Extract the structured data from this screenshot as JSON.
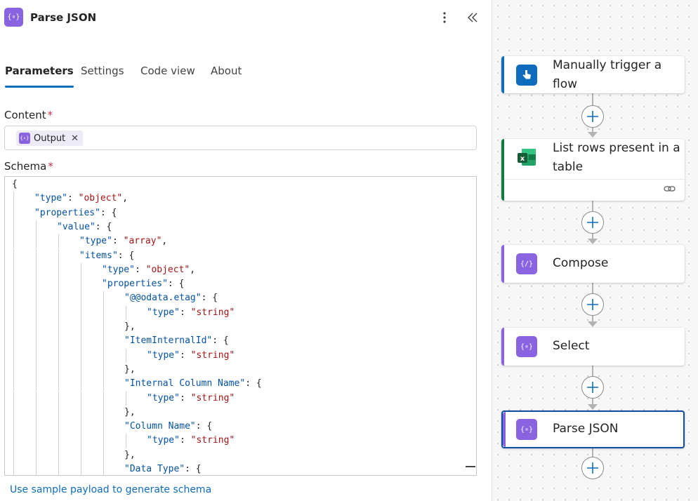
{
  "panel": {
    "title": "Parse JSON",
    "icon": "curly-braces-icon",
    "accent_color": "#8a63e0",
    "tabs": [
      {
        "label": "Parameters",
        "active": true
      },
      {
        "label": "Settings",
        "active": false
      },
      {
        "label": "Code view",
        "active": false
      },
      {
        "label": "About",
        "active": false
      }
    ]
  },
  "content_field": {
    "label": "Content",
    "required_mark": "*",
    "token_label": "Output"
  },
  "schema_field": {
    "label": "Schema",
    "required_mark": "*",
    "lines": [
      {
        "indent": 0,
        "parts": [
          [
            "p",
            "{"
          ]
        ]
      },
      {
        "indent": 1,
        "parts": [
          [
            "k",
            "\"type\""
          ],
          [
            "p",
            ": "
          ],
          [
            "s",
            "\"object\""
          ],
          [
            "p",
            ","
          ]
        ]
      },
      {
        "indent": 1,
        "parts": [
          [
            "k",
            "\"properties\""
          ],
          [
            "p",
            ": {"
          ]
        ]
      },
      {
        "indent": 2,
        "parts": [
          [
            "k",
            "\"value\""
          ],
          [
            "p",
            ": {"
          ]
        ]
      },
      {
        "indent": 3,
        "parts": [
          [
            "k",
            "\"type\""
          ],
          [
            "p",
            ": "
          ],
          [
            "s",
            "\"array\""
          ],
          [
            "p",
            ","
          ]
        ]
      },
      {
        "indent": 3,
        "parts": [
          [
            "k",
            "\"items\""
          ],
          [
            "p",
            ": {"
          ]
        ]
      },
      {
        "indent": 4,
        "parts": [
          [
            "k",
            "\"type\""
          ],
          [
            "p",
            ": "
          ],
          [
            "s",
            "\"object\""
          ],
          [
            "p",
            ","
          ]
        ]
      },
      {
        "indent": 4,
        "parts": [
          [
            "k",
            "\"properties\""
          ],
          [
            "p",
            ": {"
          ]
        ]
      },
      {
        "indent": 5,
        "parts": [
          [
            "k",
            "\"@@odata.etag\""
          ],
          [
            "p",
            ": {"
          ]
        ]
      },
      {
        "indent": 6,
        "parts": [
          [
            "k",
            "\"type\""
          ],
          [
            "p",
            ": "
          ],
          [
            "s",
            "\"string\""
          ]
        ]
      },
      {
        "indent": 5,
        "parts": [
          [
            "p",
            "},"
          ]
        ]
      },
      {
        "indent": 5,
        "parts": [
          [
            "k",
            "\"ItemInternalId\""
          ],
          [
            "p",
            ": {"
          ]
        ]
      },
      {
        "indent": 6,
        "parts": [
          [
            "k",
            "\"type\""
          ],
          [
            "p",
            ": "
          ],
          [
            "s",
            "\"string\""
          ]
        ]
      },
      {
        "indent": 5,
        "parts": [
          [
            "p",
            "},"
          ]
        ]
      },
      {
        "indent": 5,
        "parts": [
          [
            "k",
            "\"Internal Column Name\""
          ],
          [
            "p",
            ": {"
          ]
        ]
      },
      {
        "indent": 6,
        "parts": [
          [
            "k",
            "\"type\""
          ],
          [
            "p",
            ": "
          ],
          [
            "s",
            "\"string\""
          ]
        ]
      },
      {
        "indent": 5,
        "parts": [
          [
            "p",
            "},"
          ]
        ]
      },
      {
        "indent": 5,
        "parts": [
          [
            "k",
            "\"Column Name\""
          ],
          [
            "p",
            ": {"
          ]
        ]
      },
      {
        "indent": 6,
        "parts": [
          [
            "k",
            "\"type\""
          ],
          [
            "p",
            ": "
          ],
          [
            "s",
            "\"string\""
          ]
        ]
      },
      {
        "indent": 5,
        "parts": [
          [
            "p",
            "},"
          ]
        ]
      },
      {
        "indent": 5,
        "parts": [
          [
            "k",
            "\"Data Type\""
          ],
          [
            "p",
            ": {"
          ]
        ]
      }
    ]
  },
  "sample_link": "Use sample payload to generate schema",
  "flow": {
    "steps": [
      {
        "title_line1": "Manually trigger a",
        "title_line2": "flow",
        "icon": "touch-hand-icon",
        "color": "#0f6cbd"
      },
      {
        "title_line1": "List rows present in a",
        "title_line2": "table",
        "icon": "excel-icon",
        "color": "#107c41"
      },
      {
        "title_line1": "Compose",
        "title_line2": "",
        "icon": "curly-braces-icon",
        "color": "#8a63e0"
      },
      {
        "title_line1": "Select",
        "title_line2": "",
        "icon": "curly-braces-icon",
        "color": "#8a63e0"
      },
      {
        "title_line1": "Parse JSON",
        "title_line2": "",
        "icon": "curly-braces-icon",
        "color": "#8a63e0"
      }
    ]
  }
}
